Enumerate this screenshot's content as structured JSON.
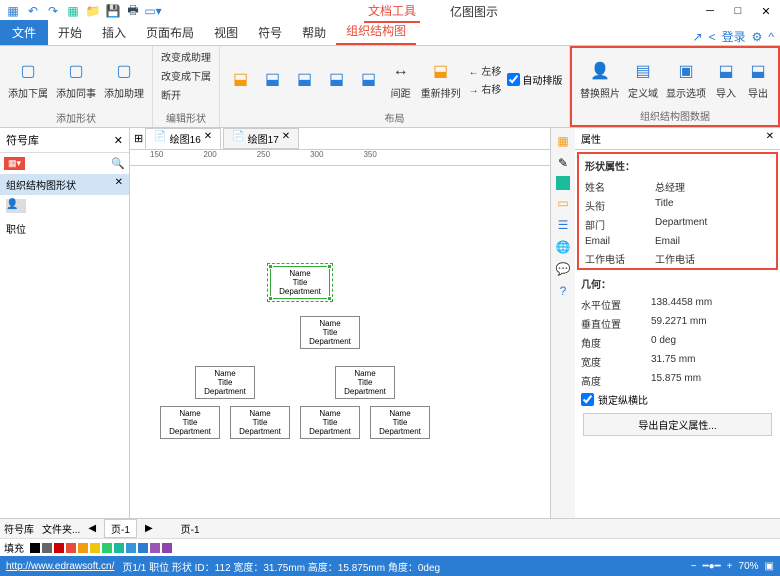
{
  "titlebar": {
    "doc_tools": "文档工具",
    "app_name": "亿图图示"
  },
  "tabs": {
    "file": "文件",
    "items": [
      "开始",
      "插入",
      "页面布局",
      "视图",
      "符号",
      "帮助",
      "组织结构图"
    ],
    "login": "登录"
  },
  "ribbon": {
    "add_shape": {
      "label": "添加形状",
      "sub": "添加下属",
      "peer": "添加同事",
      "asst": "添加助理"
    },
    "edit_shape": {
      "label": "编辑形状",
      "a": "改变成助理",
      "b": "改变成下属",
      "c": "断开"
    },
    "layout": {
      "label": "布局",
      "spacing": "间距",
      "rearr": "重新排列",
      "lr": "左移\n右移",
      "auto": "自动排版"
    },
    "data_group": {
      "label": "组织结构图数据",
      "photo": "替换照片",
      "field": "定义域",
      "display": "显示选项",
      "import": "导入",
      "export": "导出"
    }
  },
  "left": {
    "lib": "符号库",
    "cat": "组织结构图形状",
    "item": "职位"
  },
  "docs": {
    "t1": "绘图16",
    "t2": "绘图17"
  },
  "ruler": [
    "150",
    "200",
    "250",
    "300",
    "350"
  ],
  "node": {
    "l1": "Name",
    "l2": "Title",
    "l3": "Department"
  },
  "props": {
    "hdr": "属性",
    "shape_props": "形状属性：",
    "rows": {
      "name_l": "姓名",
      "name_v": "总经理",
      "title_l": "头衔",
      "title_v": "Title",
      "dept_l": "部门",
      "dept_v": "Department",
      "email_l": "Email",
      "email_v": "Email",
      "phone_l": "工作电话",
      "phone_v": "工作电话"
    },
    "geom": "几何：",
    "geo": {
      "x_l": "水平位置",
      "x_v": "138.4458 mm",
      "y_l": "垂直位置",
      "y_v": "59.2271 mm",
      "ang_l": "角度",
      "ang_v": "0 deg",
      "w_l": "宽度",
      "w_v": "31.75 mm",
      "h_l": "高度",
      "h_v": "15.875 mm"
    },
    "lock": "锁定纵横比",
    "export": "导出自定义属性..."
  },
  "bottom": {
    "sym": "符号库",
    "files": "文件夹...",
    "page1": "页-1",
    "page2": "页-1",
    "fill": "填充"
  },
  "status": {
    "url": "http://www.edrawsoft.cn/",
    "info": "页1/1  职位  形状 ID：112  宽度：31.75mm  高度：15.875mm  角度：0deg",
    "zoom": "70%"
  }
}
